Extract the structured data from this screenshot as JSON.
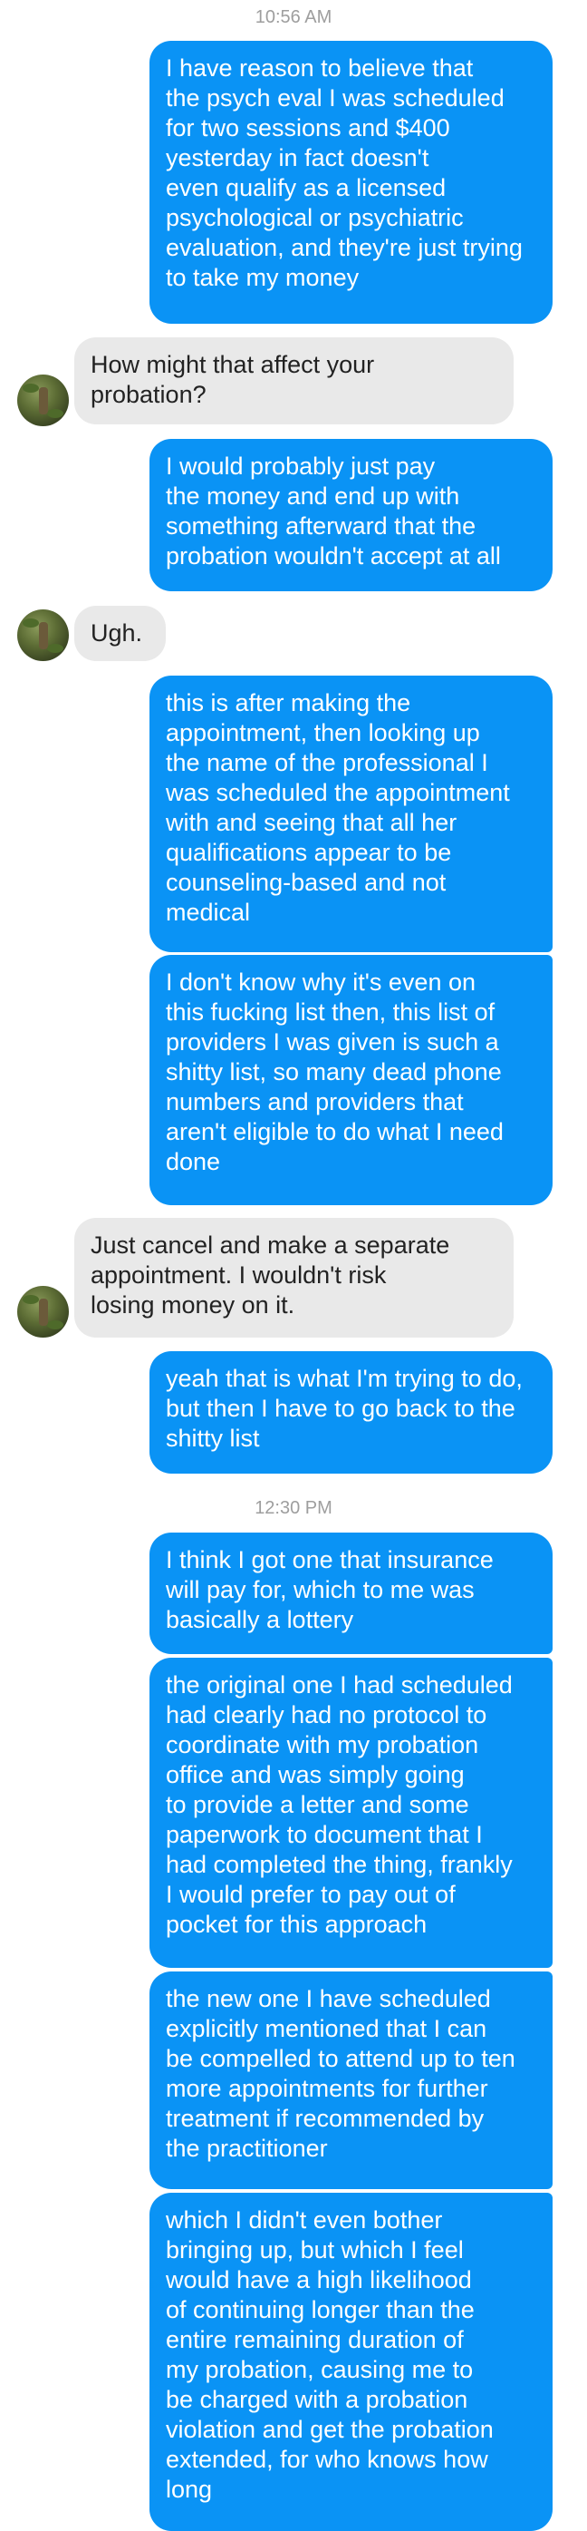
{
  "thread": {
    "timestamps": [
      "10:56 AM",
      "12:30 PM"
    ],
    "messages": [
      {
        "from": "me",
        "text": "I have reason to believe that\nthe psych eval I was scheduled\nfor two sessions and $400\nyesterday in fact doesn't\neven qualify as a licensed\npsychological or psychiatric\nevaluation, and they're just trying\nto take my money"
      },
      {
        "from": "them",
        "text": "How might that affect your\nprobation?"
      },
      {
        "from": "me",
        "text": "I would probably just pay\nthe money and end up with\nsomething afterward that the\nprobation wouldn't accept at all"
      },
      {
        "from": "them",
        "text": "Ugh."
      },
      {
        "from": "me",
        "text": "this is after making the\nappointment, then looking up\nthe name of the professional I\nwas scheduled the appointment\nwith and seeing that all her\nqualifications appear to be\ncounseling-based and not\nmedical"
      },
      {
        "from": "me",
        "text": "I don't know why it's even on\nthis fucking list then, this list of\nproviders I was given is such a\nshitty list, so many dead phone\nnumbers and providers that\naren't eligible to do what I need\ndone"
      },
      {
        "from": "them",
        "text": "Just cancel and make a separate\nappointment. I wouldn't risk\nlosing money on it."
      },
      {
        "from": "me",
        "text": "yeah that is what I'm trying to do,\nbut then I have to go back to the\nshitty list"
      },
      {
        "from": "me",
        "text": "I think I got one that insurance\nwill pay for, which to me was\nbasically a lottery"
      },
      {
        "from": "me",
        "text": "the original one I had scheduled\nhad clearly had no protocol to\ncoordinate with my probation\noffice and was simply going\nto provide a letter and some\npaperwork to document that I\nhad completed the thing, frankly\nI would prefer to pay out of\npocket for this approach"
      },
      {
        "from": "me",
        "text": "the new one I have scheduled\nexplicitly mentioned that I can\nbe compelled to attend up to ten\nmore appointments for further\ntreatment if recommended by\nthe practitioner"
      },
      {
        "from": "me",
        "text": "which I didn't even bother\nbringing up, but which I feel\nwould have a high likelihood\nof continuing longer than the\nentire remaining duration of\nmy probation, causing me to\nbe charged with a probation\nviolation and get the probation\nextended, for who knows how\nlong"
      }
    ]
  },
  "colors": {
    "outgoing_bubble": "#0a93f5",
    "incoming_bubble": "#e9e9e9",
    "timestamp_text": "#9e9e9e"
  },
  "icons": {
    "contact_avatar": "contact-avatar-icon"
  }
}
